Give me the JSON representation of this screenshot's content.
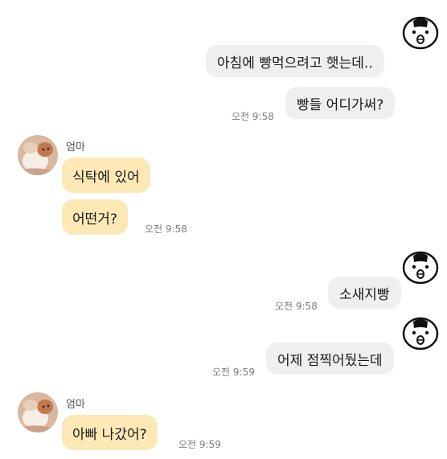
{
  "chat": {
    "messages": [
      {
        "sender": "me",
        "text": "아침에 빵먹으려고 햇는데..",
        "time": ""
      },
      {
        "sender": "me",
        "text": "빵들 어디가써?",
        "time": "오전 9:58"
      },
      {
        "sender": "mom",
        "name": "엄마",
        "text": "식탁에 있어",
        "time": ""
      },
      {
        "sender": "mom",
        "text": "어떤거?",
        "time": "오전 9:58"
      },
      {
        "sender": "me",
        "text": "소새지빵",
        "time": "오전 9:58"
      },
      {
        "sender": "me",
        "text": "어제 점찍어뒀는데",
        "time": "오전 9:59"
      },
      {
        "sender": "mom",
        "name": "엄마",
        "text": "아빠 나갔어?",
        "time": "오전 9:59"
      }
    ]
  },
  "colors": {
    "my_bubble": "#efefef",
    "mom_bubble": "#fde9b6",
    "timestamp": "#7d7d7d",
    "background": "#ffffff"
  },
  "icons": {
    "my_avatar": "cartoon-face-icon",
    "mom_avatar": "cat-photo-avatar"
  }
}
